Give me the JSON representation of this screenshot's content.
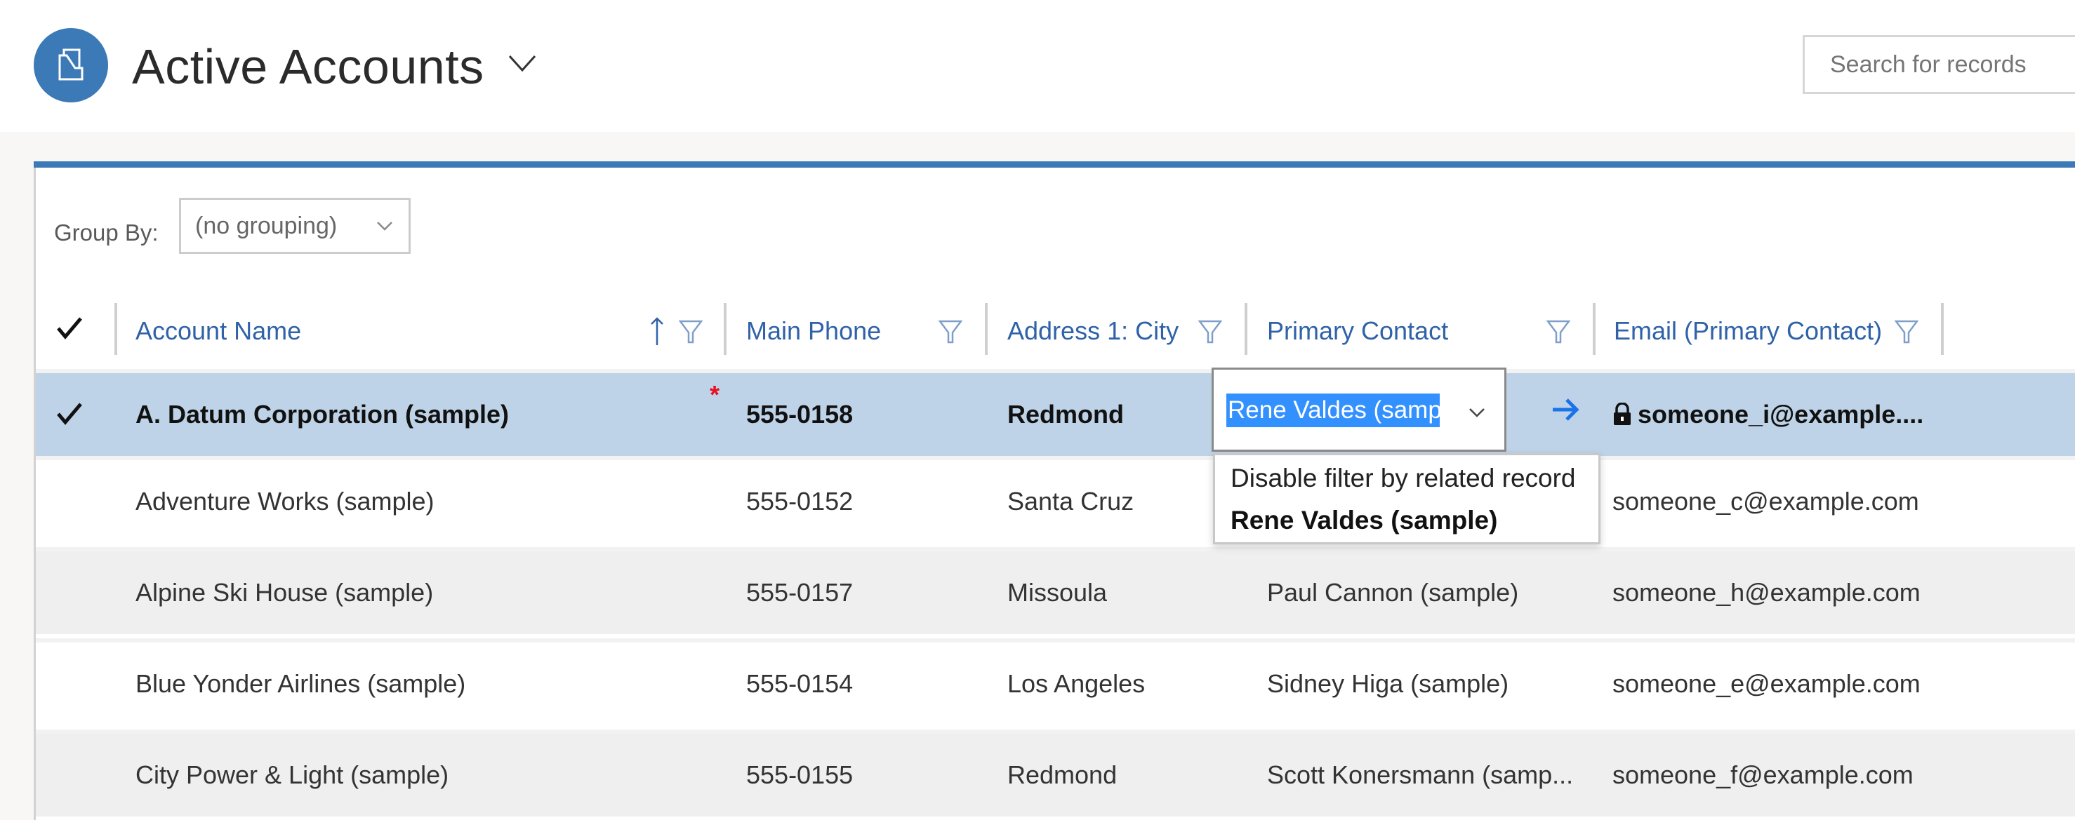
{
  "header": {
    "title": "Active Accounts",
    "app_icon": "accounts-folder-icon",
    "view_selector_icon": "chevron-down-icon",
    "search": {
      "placeholder": "Search for records",
      "value": ""
    }
  },
  "toolbar": {
    "group_by_label": "Group By:",
    "group_by_value": "(no grouping)"
  },
  "grid": {
    "columns": [
      {
        "label": "Account Name",
        "sorted": "ascending",
        "filter_icon": "filter-icon"
      },
      {
        "label": "Main Phone",
        "filter_icon": "filter-icon"
      },
      {
        "label": "Address 1: City",
        "filter_icon": "filter-icon"
      },
      {
        "label": "Primary Contact",
        "filter_icon": "filter-icon"
      },
      {
        "label": "Email (Primary Contact)",
        "filter_icon": "filter-icon"
      }
    ],
    "rows": [
      {
        "selected": true,
        "account_name": "A. Datum Corporation (sample)",
        "required_marker": "*",
        "main_phone": "555-0158",
        "city": "Redmond",
        "primary_contact": "Rene Valdes (sample",
        "email": "someone_i@example...."
      },
      {
        "selected": false,
        "account_name": "Adventure Works (sample)",
        "main_phone": "555-0152",
        "city": "Santa Cruz",
        "primary_contact": "",
        "email": "someone_c@example.com"
      },
      {
        "selected": false,
        "account_name": "Alpine Ski House (sample)",
        "main_phone": "555-0157",
        "city": "Missoula",
        "primary_contact": "Paul Cannon (sample)",
        "email": "someone_h@example.com"
      },
      {
        "selected": false,
        "account_name": "Blue Yonder Airlines (sample)",
        "main_phone": "555-0154",
        "city": "Los Angeles",
        "primary_contact": "Sidney Higa (sample)",
        "email": "someone_e@example.com"
      },
      {
        "selected": false,
        "account_name": "City Power & Light (sample)",
        "main_phone": "555-0155",
        "city": "Redmond",
        "primary_contact": "Scott Konersmann (samp...",
        "email": "someone_f@example.com"
      }
    ]
  },
  "lookup_dropdown": {
    "items": [
      "Disable filter by related record",
      "Rene Valdes (sample)"
    ]
  },
  "colors": {
    "brand": "#3b79b7",
    "header_link": "#2f62a8",
    "selected_row": "#bed3e7",
    "text_selection": "#3390ff",
    "required": "#e81123"
  }
}
